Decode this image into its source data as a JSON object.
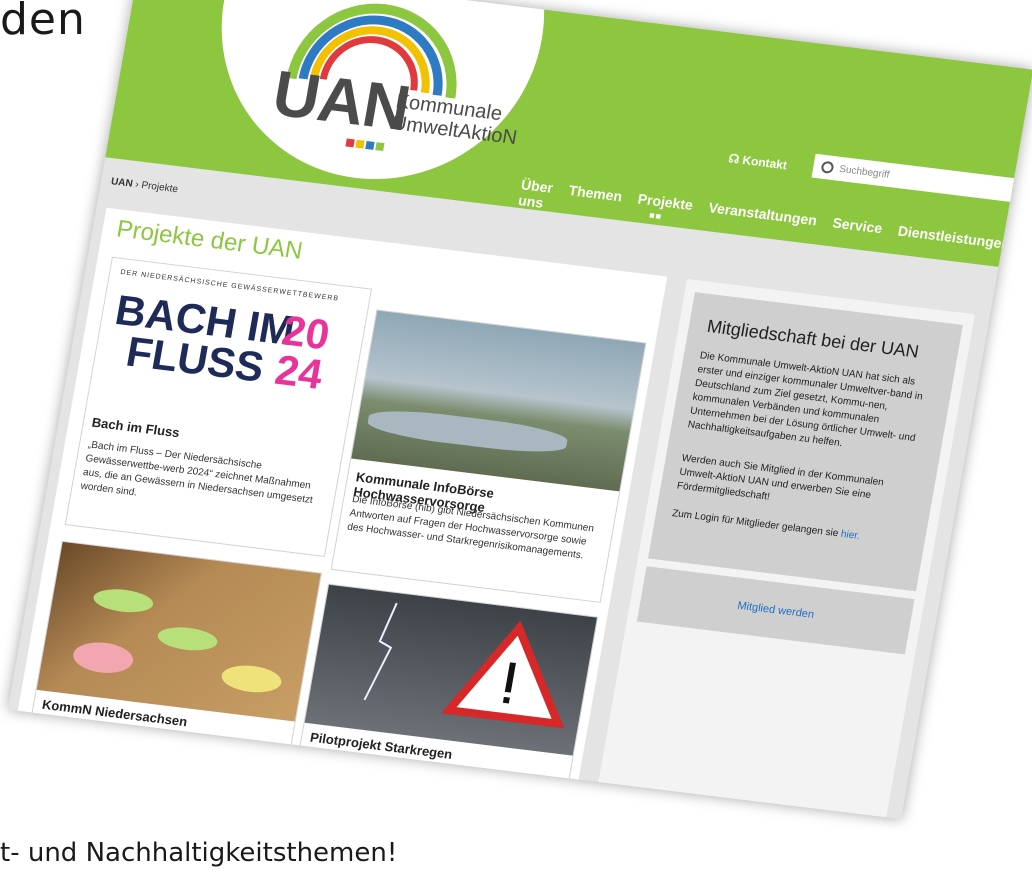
{
  "slide": {
    "top_text": "den",
    "bottom_text": "t- und Nachhaltigkeitsthemen!"
  },
  "site": {
    "logo_text": "UAN",
    "brand_line1": "Kommunale",
    "brand_line2": "UmweltAktioN",
    "contact_label": "Kontakt",
    "search_placeholder": "Suchbegriff",
    "nav": [
      {
        "label": "Über uns"
      },
      {
        "label": "Themen"
      },
      {
        "label": "Projekte"
      },
      {
        "label": "Veranstaltungen"
      },
      {
        "label": "Service"
      },
      {
        "label": "Dienstleistungen"
      }
    ],
    "breadcrumb": {
      "home": "UAN",
      "sep": "›",
      "current": "Projekte"
    },
    "page_title": "Projekte der UAN",
    "cards": [
      {
        "title": "Bach im Fluss",
        "text": "„Bach im Fluss – Der Niedersächsische Gewässerwettbe-werb 2024“ zeichnet Maßnahmen aus, die an Gewässern in Niedersachsen umgesetzt worden sind.",
        "banner_small": "DER NIEDERSÄCHSISCHE GEWÄSSERWETTBEWERB",
        "banner_big1": "BACH IM",
        "banner_big2": "FLUSS",
        "banner_year1": "20",
        "banner_year2": "24"
      },
      {
        "title": "Kommunale InfoBörse Hochwasservorsorge",
        "text": "Die InfoBörse (hib) gibt Niedersächsischen Kommunen Antworten auf Fragen der Hochwasservorsorge sowie des Hochwasser- und Starkregenrisikomanagements."
      },
      {
        "title": "KommN Niedersachsen"
      },
      {
        "title": "Pilotprojekt Starkregen"
      }
    ],
    "membership": {
      "title": "Mitgliedschaft bei der UAN",
      "para1": "Die Kommunale Umwelt-AktioN UAN hat sich als erster und einziger kommunaler Umweltver-band in Deutschland zum Ziel gesetzt, Kommu-nen, kommunalen Verbänden und kommunalen Unternehmen bei der Lösung örtlicher Umwelt- und Nachhaltigkeitsaufgaben zu helfen.",
      "para2": "Werden auch Sie Mitglied in der Kommunalen Umwelt-AktioN UAN und erwerben Sie eine Fördermitgliedschaft!",
      "login_prefix": "Zum Login für Mitglieder gelangen sie ",
      "login_link": "hier.",
      "cta": "Mitglied werden"
    }
  },
  "colors": {
    "brand_green": "#8dc63f",
    "link_blue": "#1f6fc6"
  }
}
